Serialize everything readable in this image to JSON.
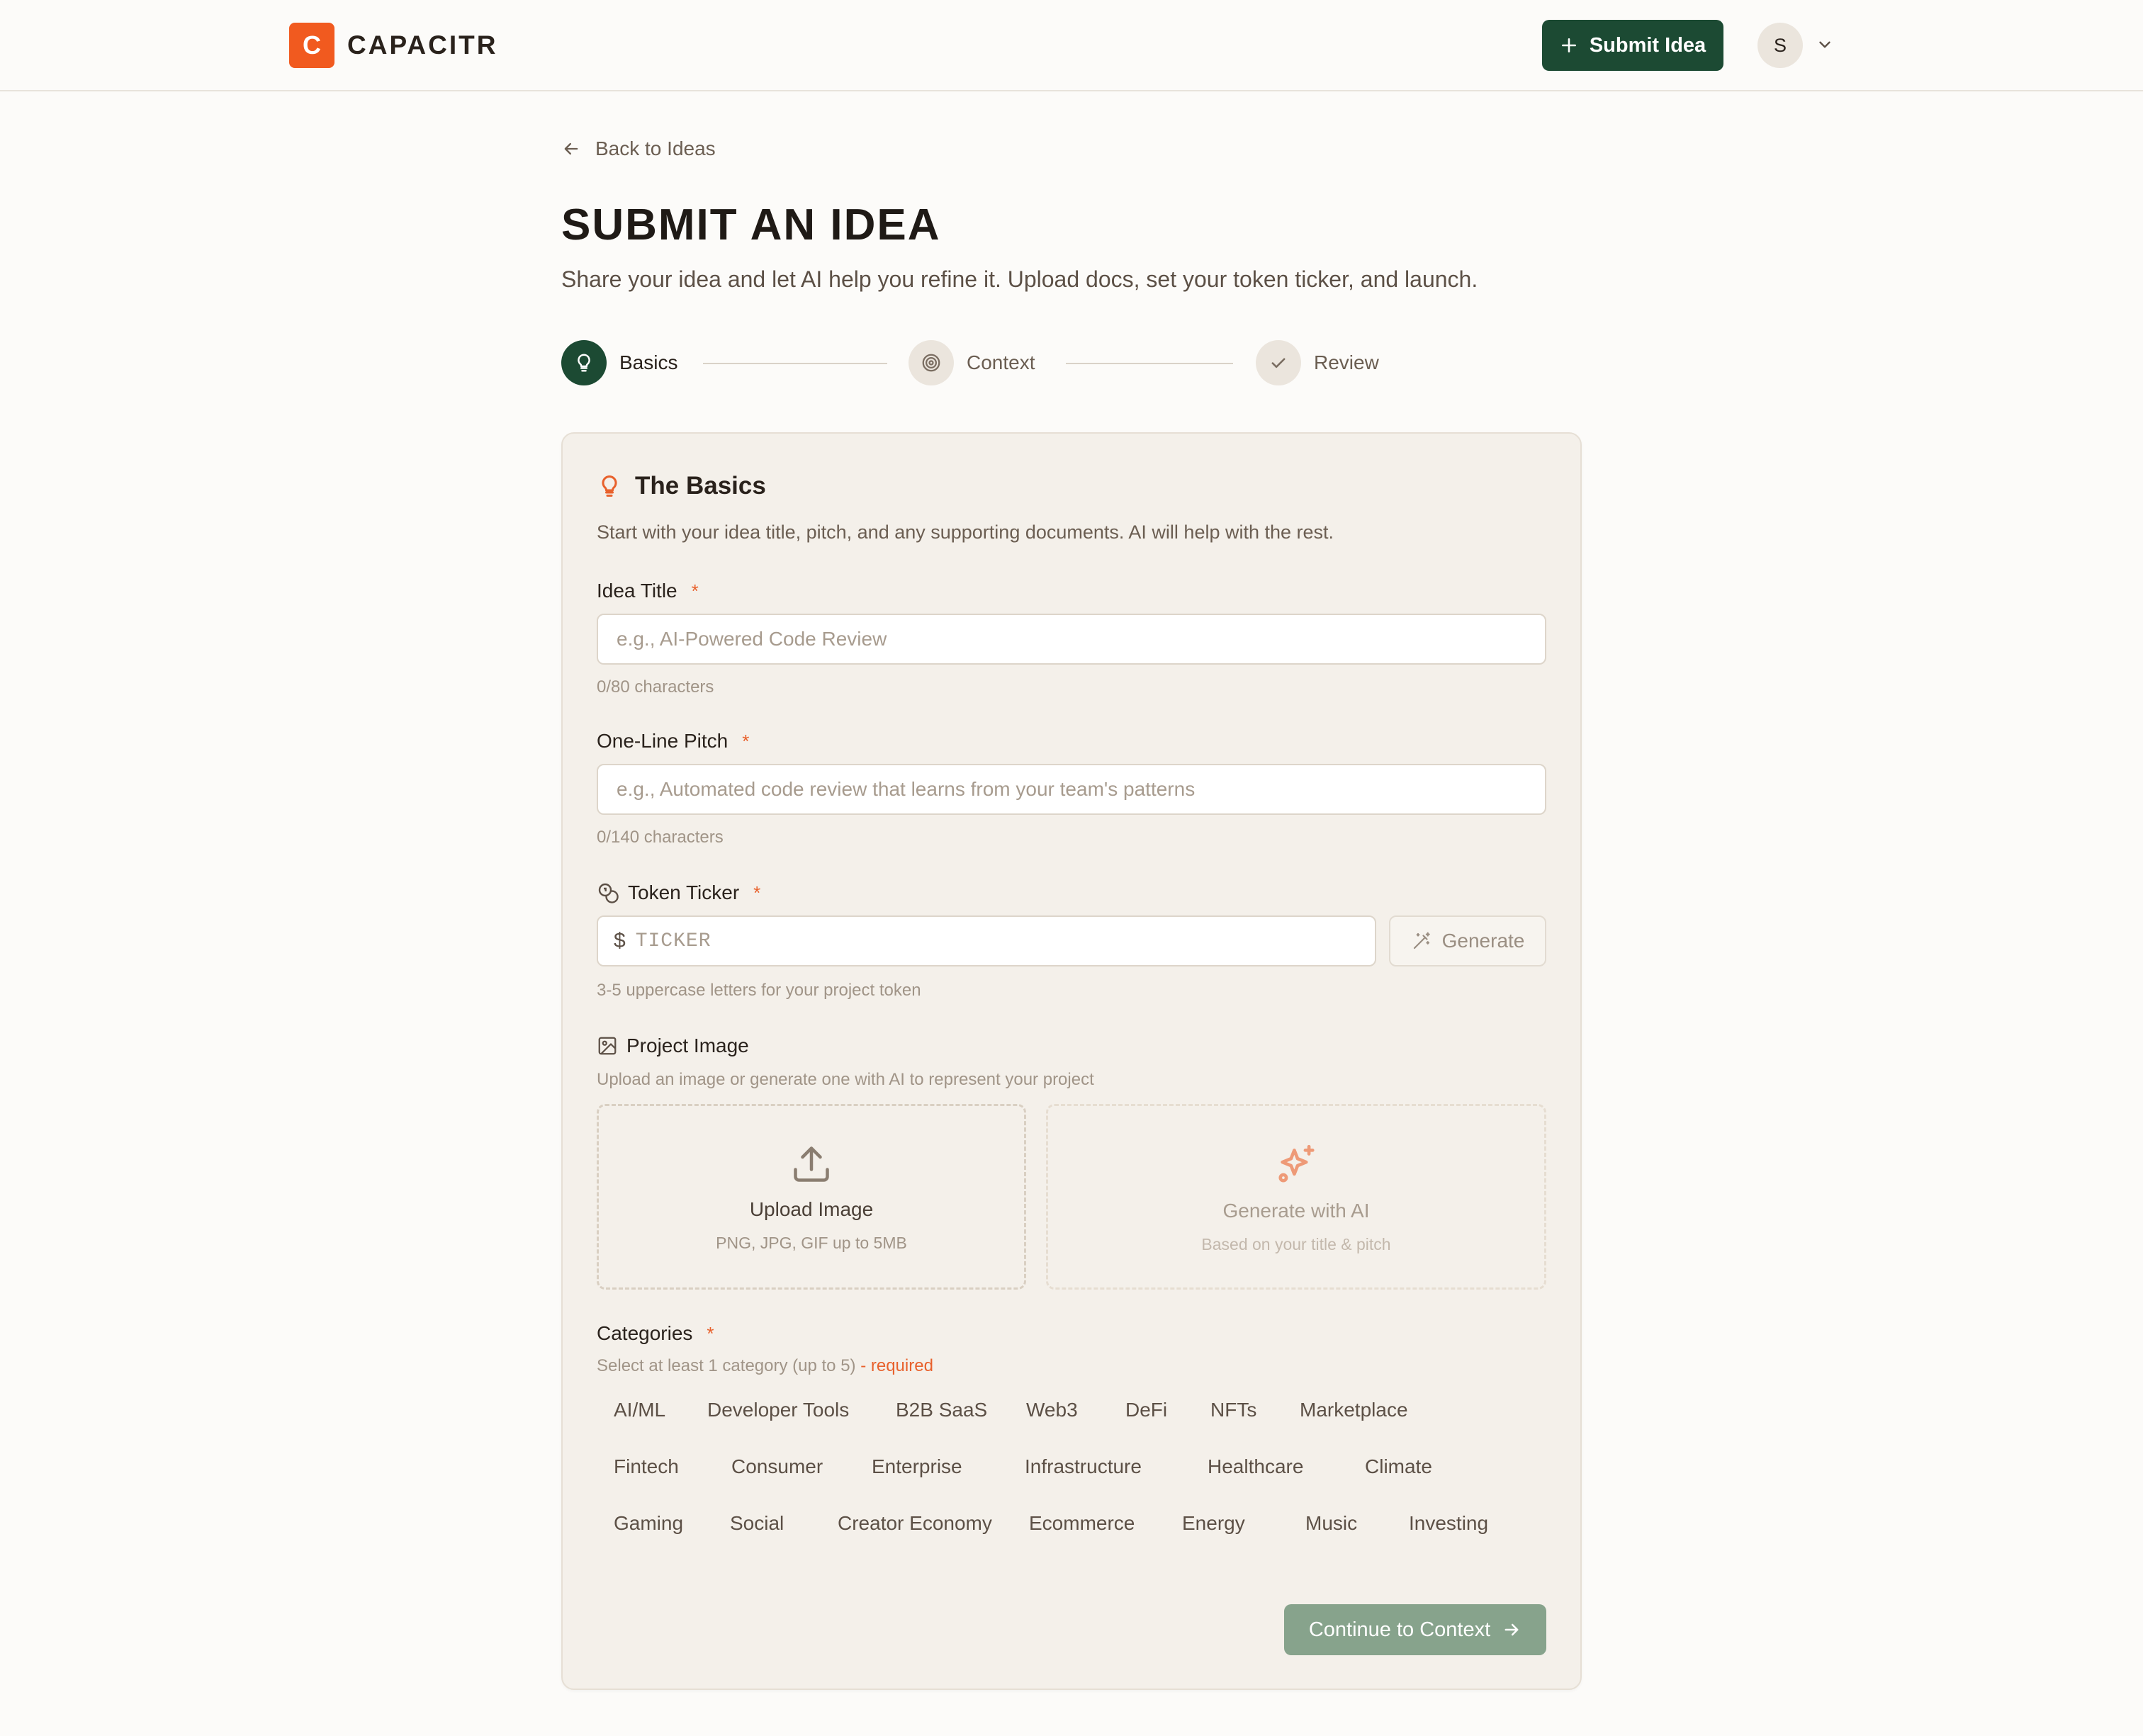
{
  "app": {
    "logo_letter": "C",
    "brand": "CAPACITR",
    "submit_idea_label": "Submit Idea",
    "avatar_initial": "S"
  },
  "page": {
    "back_label": "Back to Ideas",
    "title": "SUBMIT AN IDEA",
    "subtitle": "Share your idea and let AI help you refine it. Upload docs, set your token ticker, and launch."
  },
  "steps": [
    {
      "label": "Basics",
      "state": "active"
    },
    {
      "label": "Context",
      "state": "pending"
    },
    {
      "label": "Review",
      "state": "pending"
    }
  ],
  "card": {
    "title": "The Basics",
    "description": "Start with your idea title, pitch, and any supporting documents. AI will help with the rest."
  },
  "fields": {
    "title": {
      "label": "Idea Title",
      "required_mark": "*",
      "placeholder": "e.g., AI-Powered Code Review",
      "counter": "0/80 characters"
    },
    "pitch": {
      "label": "One-Line Pitch",
      "required_mark": "*",
      "placeholder": "e.g., Automated code review that learns from your team's patterns",
      "counter": "0/140 characters"
    },
    "ticker": {
      "label": "Token Ticker",
      "required_mark": "*",
      "prefix": "$",
      "placeholder": "TICKER",
      "generate_label": "Generate",
      "hint": "3-5 uppercase letters for your project token"
    },
    "image": {
      "label": "Project Image",
      "hint": "Upload an image or generate one with AI to represent your project",
      "upload_title": "Upload Image",
      "upload_sub": "PNG, JPG, GIF up to 5MB",
      "ai_title": "Generate with AI",
      "ai_sub": "Based on your title & pitch"
    },
    "categories": {
      "label": "Categories",
      "required_mark": "*",
      "hint": "Select at least 1 category (up to 5)",
      "hint_required": "- required",
      "items": [
        "AI/ML",
        "Developer Tools",
        "B2B SaaS",
        "Web3",
        "DeFi",
        "NFTs",
        "Marketplace",
        "Fintech",
        "Consumer",
        "Enterprise",
        "Infrastructure",
        "Healthcare",
        "Climate",
        "Gaming",
        "Social",
        "Creator Economy",
        "Ecommerce",
        "Energy",
        "Music",
        "Investing"
      ]
    }
  },
  "actions": {
    "continue_label": "Continue to Context"
  },
  "colors": {
    "brand_orange": "#f15a1f",
    "primary_green": "#1c4a33",
    "disabled_green": "#87a38c",
    "accent_orange": "#e8612c"
  }
}
